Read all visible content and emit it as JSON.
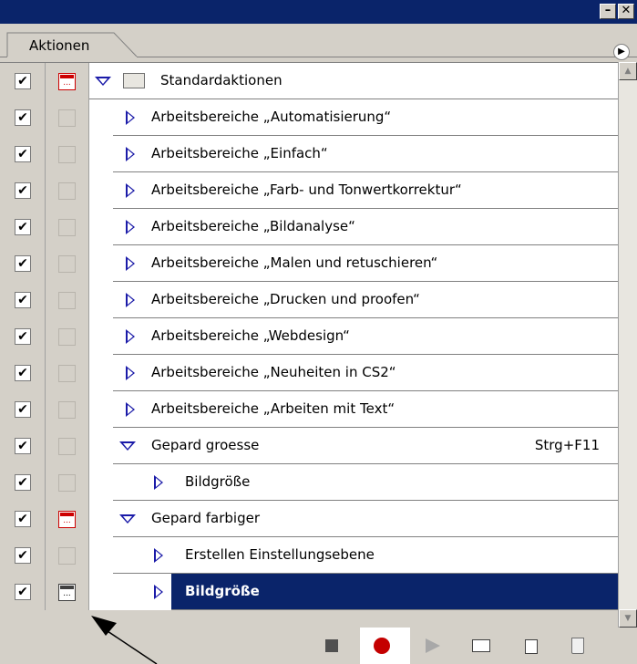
{
  "window": {
    "minimize_glyph": "–",
    "close_glyph": "✕"
  },
  "tab": {
    "label": "Aktionen"
  },
  "rows": [
    {
      "label": "Standardaktionen",
      "indent": 0,
      "expander": "down",
      "folder": true,
      "check": "✔",
      "dialog": "red",
      "shortcut": ""
    },
    {
      "label": "Arbeitsbereiche „Automatisierung“",
      "indent": 1,
      "expander": "right",
      "check": "✔",
      "dialog": "empty",
      "shortcut": ""
    },
    {
      "label": "Arbeitsbereiche „Einfach“",
      "indent": 1,
      "expander": "right",
      "check": "✔",
      "dialog": "empty",
      "shortcut": ""
    },
    {
      "label": "Arbeitsbereiche „Farb- und Tonwertkorrektur“",
      "indent": 1,
      "expander": "right",
      "check": "✔",
      "dialog": "empty",
      "shortcut": ""
    },
    {
      "label": "Arbeitsbereiche „Bildanalyse“",
      "indent": 1,
      "expander": "right",
      "check": "✔",
      "dialog": "empty",
      "shortcut": ""
    },
    {
      "label": "Arbeitsbereiche „Malen und retuschieren“",
      "indent": 1,
      "expander": "right",
      "check": "✔",
      "dialog": "empty",
      "shortcut": ""
    },
    {
      "label": "Arbeitsbereiche „Drucken und proofen“",
      "indent": 1,
      "expander": "right",
      "check": "✔",
      "dialog": "empty",
      "shortcut": ""
    },
    {
      "label": "Arbeitsbereiche „Webdesign“",
      "indent": 1,
      "expander": "right",
      "check": "✔",
      "dialog": "empty",
      "shortcut": ""
    },
    {
      "label": "Arbeitsbereiche „Neuheiten in CS2“",
      "indent": 1,
      "expander": "right",
      "check": "✔",
      "dialog": "empty",
      "shortcut": ""
    },
    {
      "label": "Arbeitsbereiche „Arbeiten mit Text“",
      "indent": 1,
      "expander": "right",
      "check": "✔",
      "dialog": "empty",
      "shortcut": ""
    },
    {
      "label": "Gepard groesse",
      "indent": 0,
      "expander": "down",
      "check": "✔",
      "dialog": "empty",
      "shortcut": "Strg+F11"
    },
    {
      "label": "Bildgröße",
      "indent": 1,
      "expander": "right",
      "check": "✔",
      "dialog": "empty",
      "shortcut": ""
    },
    {
      "label": "Gepard farbiger",
      "indent": 0,
      "expander": "down",
      "check": "✔",
      "dialog": "red",
      "shortcut": ""
    },
    {
      "label": "Erstellen Einstellungsebene",
      "indent": 1,
      "expander": "right",
      "check": "✔",
      "dialog": "empty",
      "shortcut": ""
    },
    {
      "label": "Bildgröße",
      "indent": 1,
      "expander": "right",
      "check": "✔",
      "dialog": "black",
      "shortcut": "",
      "selected": true
    }
  ],
  "dialog_glyph": "...",
  "scrollbar": {
    "up_glyph": "▲",
    "down_glyph": "▼"
  },
  "toolbar": {
    "stop": "stop-icon",
    "record": "record-icon",
    "play": "play-icon",
    "new_set": "folder-icon",
    "new_action": "new-action-icon",
    "delete": "trash-icon"
  },
  "colors": {
    "title_bar": "#0a246a",
    "selection": "#0a246a",
    "expander": "#1a1aa8",
    "record": "#c40000",
    "dialog_marker": "#cc0000"
  }
}
